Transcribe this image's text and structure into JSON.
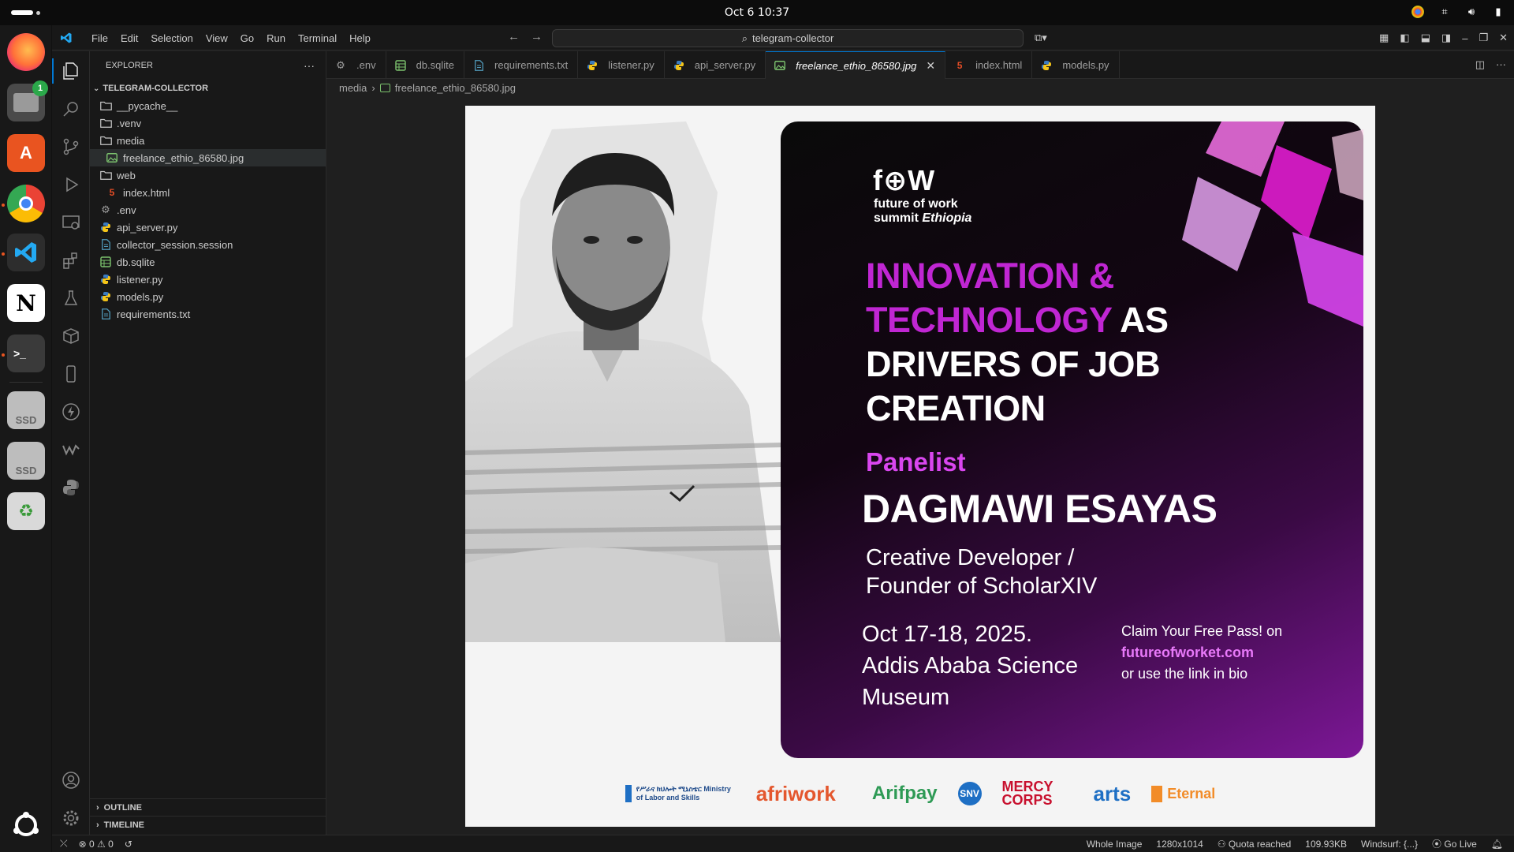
{
  "system": {
    "clock": "Oct 6  10:37"
  },
  "dock": {
    "files_badge": "1",
    "ssd1": "SSD",
    "ssd2": "SSD"
  },
  "menu": [
    "File",
    "Edit",
    "Selection",
    "View",
    "Go",
    "Run",
    "Terminal",
    "Help"
  ],
  "command_center": {
    "text": "telegram-collector"
  },
  "explorer": {
    "title": "EXPLORER",
    "more": "···",
    "project": "TELEGRAM-COLLECTOR",
    "items": [
      {
        "label": "__pycache__",
        "kind": "folder",
        "indent": 0
      },
      {
        "label": ".venv",
        "kind": "folder",
        "indent": 0
      },
      {
        "label": "media",
        "kind": "folder",
        "indent": 0
      },
      {
        "label": "freelance_ethio_86580.jpg",
        "kind": "image",
        "indent": 1,
        "selected": true
      },
      {
        "label": "web",
        "kind": "folder",
        "indent": 0
      },
      {
        "label": "index.html",
        "kind": "html",
        "indent": 1
      },
      {
        "label": ".env",
        "kind": "gear",
        "indent": 0
      },
      {
        "label": "api_server.py",
        "kind": "python",
        "indent": 0
      },
      {
        "label": "collector_session.session",
        "kind": "file",
        "indent": 0
      },
      {
        "label": "db.sqlite",
        "kind": "db",
        "indent": 0
      },
      {
        "label": "listener.py",
        "kind": "python",
        "indent": 0
      },
      {
        "label": "models.py",
        "kind": "python",
        "indent": 0
      },
      {
        "label": "requirements.txt",
        "kind": "file",
        "indent": 0
      }
    ],
    "outline": "OUTLINE",
    "timeline": "TIMELINE"
  },
  "tabs": [
    {
      "label": ".env",
      "kind": "gear"
    },
    {
      "label": "db.sqlite",
      "kind": "db"
    },
    {
      "label": "requirements.txt",
      "kind": "file"
    },
    {
      "label": "listener.py",
      "kind": "python"
    },
    {
      "label": "api_server.py",
      "kind": "python"
    },
    {
      "label": "freelance_ethio_86580.jpg",
      "kind": "image",
      "active": true
    },
    {
      "label": "index.html",
      "kind": "html"
    },
    {
      "label": "models.py",
      "kind": "python"
    }
  ],
  "breadcrumb": {
    "folder": "media",
    "file": "freelance_ethio_86580.jpg"
  },
  "poster": {
    "logo": "f⊕W",
    "logo_line1": "future of work",
    "logo_line2a": "summit ",
    "logo_line2b": "Ethiopia",
    "headline_1": "INNOVATION &",
    "headline_2a": "TECHNOLOGY",
    "headline_2b": " AS",
    "headline_3": "DRIVERS OF JOB",
    "headline_4": "CREATION",
    "panelist": "Panelist",
    "name": "DAGMAWI ESAYAS",
    "role_1": "Creative Developer /",
    "role_2": "Founder of ScholarXIV",
    "date_1": "Oct 17-18, 2025.",
    "date_2": "Addis Ababa Science",
    "date_3": "Museum",
    "claim_1": "Claim Your Free Pass! on",
    "claim_link": "futureofworket.com",
    "claim_2": "or use the link in bio",
    "sponsors": [
      "የሥራና ክህሎት ሚኒስቴር Ministry of Labor and Skills",
      "afriwork",
      "Arifpay",
      "SNV",
      "MERCY CORPS",
      "arts",
      "Eternal"
    ]
  },
  "status": {
    "errors": "0",
    "warnings": "0",
    "view": "Whole Image",
    "dimensions": "1280x1014",
    "quota": "Quota reached",
    "size": "109.93KB",
    "windsurf": "Windsurf: {...}",
    "golive": "Go Live"
  },
  "colors": {
    "accent": "#0078d4",
    "poster_pink": "#c026d3",
    "poster_link": "#e879f9"
  }
}
